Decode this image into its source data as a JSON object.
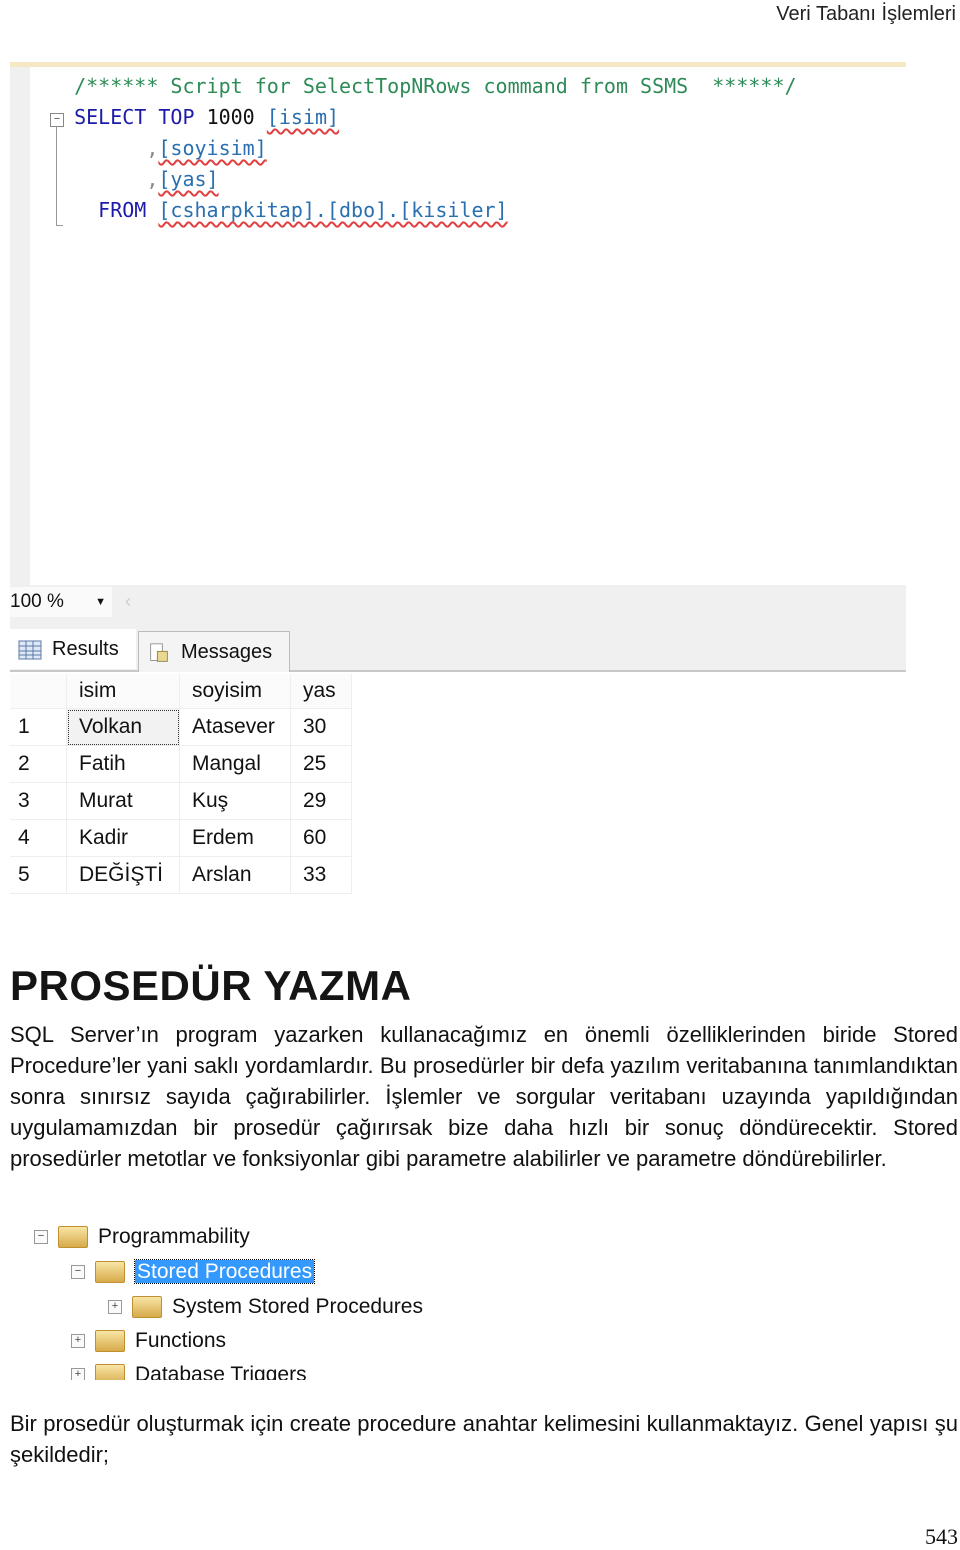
{
  "header": {
    "chapter_title": "Veri Tabanı İşlemleri"
  },
  "sql_editor": {
    "comment": "/****** Script for SelectTopNRows command from SSMS  ******/",
    "kw_select": "SELECT",
    "kw_top": "TOP",
    "top_n": "1000",
    "col1": "[isim]",
    "comma": ",",
    "col2": "[soyisim]",
    "col3": "[yas]",
    "kw_from": "FROM",
    "table": "[csharpkitap].[dbo].[kisiler]",
    "fold_symbol": "−"
  },
  "results_pane": {
    "zoom_level": "100 %",
    "tabs": [
      {
        "label": "Results",
        "icon": "grid-icon",
        "active": true
      },
      {
        "label": "Messages",
        "icon": "messages-icon",
        "active": false
      }
    ],
    "columns": [
      "isim",
      "soyisim",
      "yas"
    ],
    "rows": [
      {
        "n": "1",
        "isim": "Volkan",
        "soyisim": "Atasever",
        "yas": "30"
      },
      {
        "n": "2",
        "isim": "Fatih",
        "soyisim": "Mangal",
        "yas": "25"
      },
      {
        "n": "3",
        "isim": "Murat",
        "soyisim": "Kuş",
        "yas": "29"
      },
      {
        "n": "4",
        "isim": "Kadir",
        "soyisim": "Erdem",
        "yas": "60"
      },
      {
        "n": "5",
        "isim": "DEĞİŞTİ",
        "soyisim": "Arslan",
        "yas": "33"
      }
    ]
  },
  "section": {
    "heading": "PROSEDÜR YAZMA",
    "paragraph1": "SQL Server’ın program yazarken kullanacağımız en önemli özelliklerinden biride Stored Procedure’ler yani saklı yordamlardır. Bu prosedürler bir defa yazılım veritabanına tanımlandıktan sonra sınırsız sayıda çağırabilirler. İşlemler ve sorgular veritabanı uzayında yapıldığından uygulamamızdan bir prosedür çağırırsak bize daha hızlı bir sonuç döndürecektir. Stored prosedürler metotlar ve fonksiyonlar gibi parametre alabilirler ve parametre döndürebilirler.",
    "paragraph2": "Bir prosedür oluşturmak için create procedure anahtar kelimesini kullanmaktayız. Genel yapısı şu şekildedir;"
  },
  "object_explorer": {
    "nodes": [
      {
        "label": "Programmability",
        "expander": "−",
        "selected": false
      },
      {
        "label": "Stored Procedures",
        "expander": "−",
        "selected": true
      },
      {
        "label": "System Stored Procedures",
        "expander": "+",
        "selected": false
      },
      {
        "label": "Functions",
        "expander": "+",
        "selected": false
      },
      {
        "label": "Database Triggers",
        "expander": "+",
        "selected": false
      }
    ],
    "selection_color": "#3399ff"
  },
  "footer": {
    "page_number": "543"
  }
}
